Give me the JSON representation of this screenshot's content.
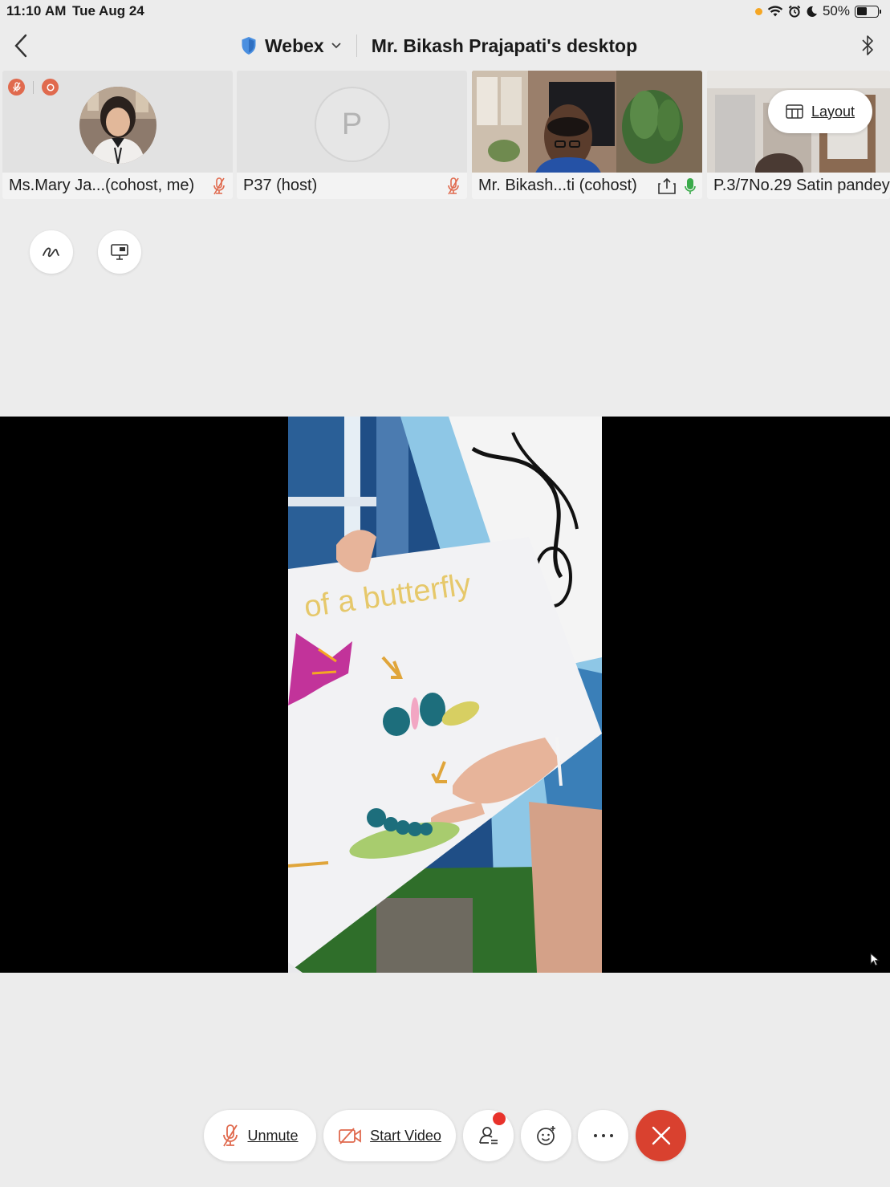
{
  "status_bar": {
    "time": "11:10 AM",
    "date": "Tue Aug 24",
    "battery": "50%",
    "battery_level": 0.5
  },
  "title_bar": {
    "app_name": "Webex",
    "desktop_title": "Mr. Bikash Prajapati's desktop"
  },
  "participants": [
    {
      "name": "Ms.Mary Ja...(cohost, me)",
      "muted": true
    },
    {
      "name": "P37 (host)",
      "avatar_letter": "P",
      "muted": true
    },
    {
      "name": "Mr. Bikash...ti (cohost)",
      "muted": false,
      "sharing": true
    },
    {
      "name": "P.3/7No.29 Satin pandey"
    }
  ],
  "layout_button": {
    "label": "Layout"
  },
  "share": {
    "poster_text": "of a butterfly"
  },
  "controls": {
    "unmute_label": "Unmute",
    "start_video_label": "Start Video"
  },
  "colors": {
    "accent_red": "#d9412f",
    "badge_orange": "#e06a4e",
    "mic_green": "#3aaa4a",
    "notification_red": "#e8322b"
  }
}
